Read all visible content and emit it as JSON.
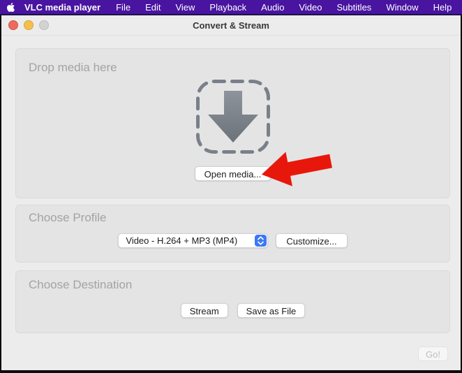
{
  "menubar": {
    "apple_icon": "apple-logo",
    "app_name": "VLC media player",
    "items": [
      "File",
      "Edit",
      "View",
      "Playback",
      "Audio",
      "Video",
      "Subtitles",
      "Window",
      "Help"
    ]
  },
  "titlebar": {
    "title": "Convert & Stream",
    "close_icon": "close-traffic-light",
    "minimize_icon": "minimize-traffic-light",
    "zoom_icon": "zoom-traffic-light-disabled"
  },
  "drop_section": {
    "label": "Drop media here",
    "drop_icon": "download-arrow-in-dashed-box",
    "open_media_label": "Open media..."
  },
  "profile_section": {
    "label": "Choose Profile",
    "selected_profile": "Video - H.264 + MP3 (MP4)",
    "stepper_icon": "up-down-chevrons",
    "customize_label": "Customize..."
  },
  "destination_section": {
    "label": "Choose Destination",
    "stream_label": "Stream",
    "save_label": "Save as File"
  },
  "footer": {
    "go_label": "Go!",
    "go_state": "disabled"
  },
  "annotation": {
    "red_arrow_icon": "red-arrow-pointing-left-at-open-media-button",
    "color": "#e8170c"
  },
  "colors": {
    "menubar_purple": "#4814a0",
    "window_bg": "#ececec",
    "panel_bg": "#e4e4e4",
    "stepper_blue": "#3b78f6",
    "traffic_red": "#ed6a5e",
    "traffic_yellow": "#f5bf4f",
    "traffic_gray": "#d2d2d2",
    "dashed_border_gray": "#798089"
  }
}
